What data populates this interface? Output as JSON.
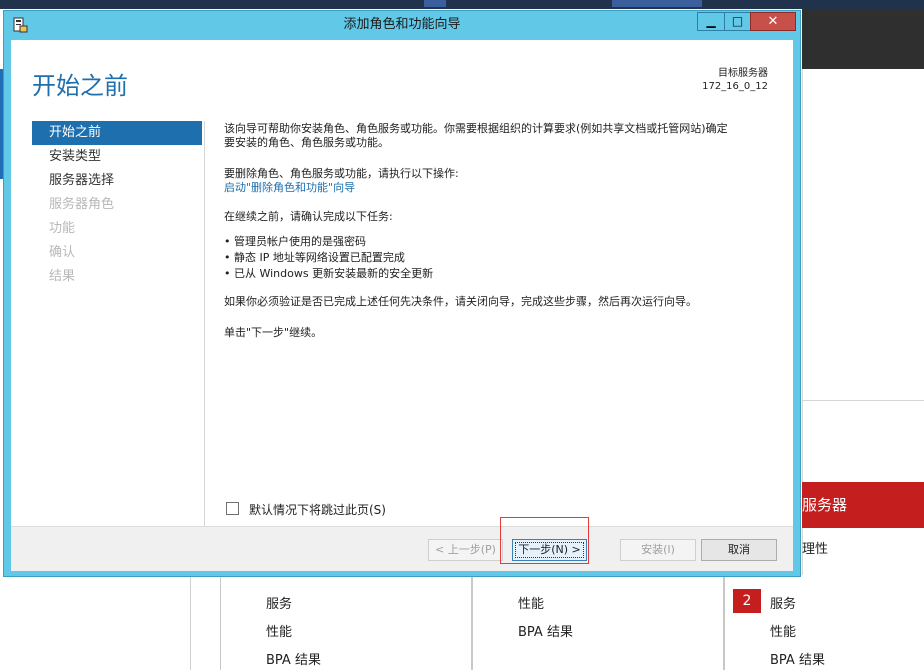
{
  "background": {
    "server_header": "服务器",
    "server_sub": "理性",
    "badge": "2",
    "col1_items": [
      "服务",
      "性能",
      "BPA 结果"
    ],
    "col2_items": [
      "性能",
      "BPA 结果"
    ],
    "col3_items": [
      "服务",
      "性能",
      "BPA 结果"
    ]
  },
  "window": {
    "title": "添加角色和功能向导",
    "controls": {
      "minimize": "▁",
      "maximize": "□",
      "close": "✕"
    }
  },
  "header": {
    "page_title": "开始之前",
    "destination_label": "目标服务器",
    "destination_value": "172_16_0_12"
  },
  "nav": {
    "items": [
      {
        "label": "开始之前",
        "state": "active"
      },
      {
        "label": "安装类型",
        "state": "normal"
      },
      {
        "label": "服务器选择",
        "state": "normal"
      },
      {
        "label": "服务器角色",
        "state": "disabled"
      },
      {
        "label": "功能",
        "state": "disabled"
      },
      {
        "label": "确认",
        "state": "disabled"
      },
      {
        "label": "结果",
        "state": "disabled"
      }
    ]
  },
  "content": {
    "intro_line1": "该向导可帮助你安装角色、角色服务或功能。你需要根据组织的计算要求(例如共享文档或托管网站)确定",
    "intro_line2": "要安装的角色、角色服务或功能。",
    "remove_text": "要删除角色、角色服务或功能，请执行以下操作:",
    "remove_link": "启动\"删除角色和功能\"向导",
    "confirm_heading": "在继续之前，请确认完成以下任务:",
    "bullets": [
      "管理员帐户使用的是强密码",
      "静态 IP 地址等网络设置已配置完成",
      "已从 Windows 更新安装最新的安全更新"
    ],
    "verify_text": "如果你必须验证是否已完成上述任何先决条件，请关闭向导，完成这些步骤，然后再次运行向导。",
    "continue_text": "单击\"下一步\"继续。"
  },
  "skip": {
    "label": "默认情况下将跳过此页(S)",
    "checked": false
  },
  "footer": {
    "prev": "< 上一步(P)",
    "next": "下一步(N) >",
    "install": "安装(I)",
    "cancel": "取消"
  },
  "colors": {
    "accent": "#1e6fae",
    "titlebar": "#62c8e8",
    "close": "#c7504a",
    "highlight": "#e53b3b",
    "server_red": "#c41e1e"
  }
}
